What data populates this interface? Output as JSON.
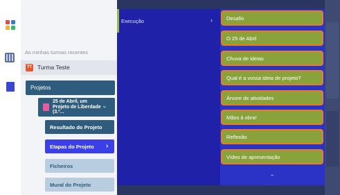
{
  "rail": {
    "icons": [
      "apps-icon",
      "grid-icon",
      "square-icon"
    ],
    "apps_colors": [
      "#e24a4a",
      "#3a7bd5",
      "#f2b233",
      "#3ab873"
    ]
  },
  "sidebar": {
    "recent_label": "As minhas turmas recentes",
    "class": {
      "avatar": "TT",
      "name": "Turma Teste"
    },
    "projects_label": "Projetos",
    "project": {
      "title": "25 de Abril, um Projeto de Liberdade (3.º..."
    },
    "sub_items": [
      {
        "label": "Resultado do Projeto"
      },
      {
        "label": "Etapas do Projeto",
        "chevron": "›"
      },
      {
        "label": "Ficheiros"
      },
      {
        "label": "Mural do Projeto"
      }
    ]
  },
  "submenu": {
    "item": {
      "label": "Execução",
      "chevron": "›"
    }
  },
  "stages": {
    "items": [
      "Desafio",
      "O 25 de Abril",
      "Chuva de ideias",
      "Qual é a vossa ideia de projeto?",
      "Árvore de atividades",
      "Mãos à obra!",
      "Reflexão",
      "Vídeo de apresentação"
    ],
    "more": "›"
  },
  "colors": {
    "sidebar_bg": "#f3f4f7",
    "project_bg": "#2f5c7c",
    "active_bg": "#3a3fe8",
    "submenu_bg": "#1f22a8",
    "stages_bg": "#2b32c6",
    "stage_fill": "#8aa23c",
    "stage_border": "#f07a22"
  }
}
